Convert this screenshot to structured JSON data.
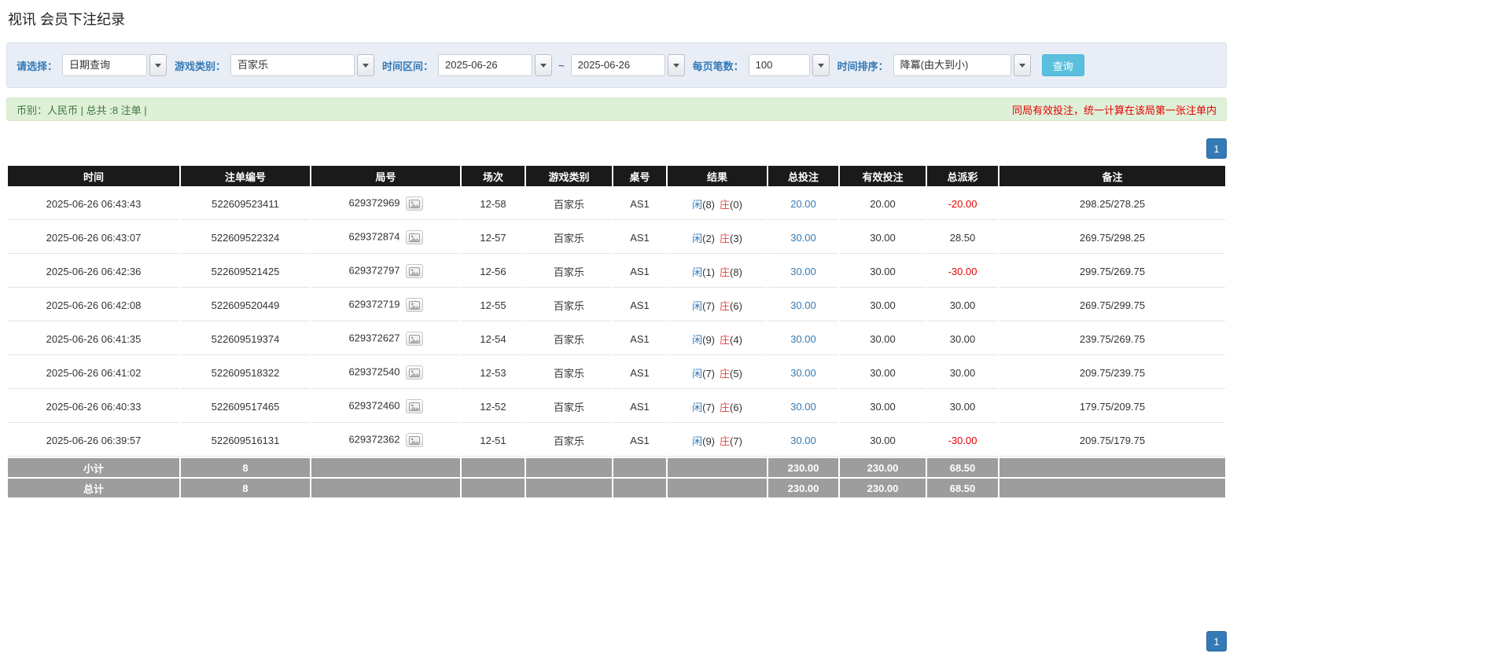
{
  "page": {
    "title": "视讯 会员下注纪录"
  },
  "colors": {
    "accent_blue": "#337ab7",
    "player_blue": "#337ab7",
    "banker_red": "#d9534f",
    "negative_red": "#e60000",
    "search_button_blue": "#5bc0de",
    "header_black": "#1a1a1a",
    "total_row_gray": "#9d9d9d",
    "summary_green_bg": "#dff0d8"
  },
  "filters": {
    "select_label": "请选择：",
    "select_value": "日期查询",
    "game_type_label": "游戏类别：",
    "game_type_value": "百家乐",
    "time_range_label": "时间区间：",
    "date_from": "2025-06-26",
    "tilde": "~",
    "date_to": "2025-06-26",
    "page_size_label": "每页笔数：",
    "page_size_value": "100",
    "sort_label": "时间排序：",
    "sort_value": "降冪(由大到小)",
    "search_button": "查询"
  },
  "summary": {
    "left": "币别：人民币 | 总共 :8 注单 |",
    "right_note": "同局有效投注，统一计算在该局第一张注单内"
  },
  "pagination": {
    "page": "1"
  },
  "table": {
    "headers": [
      "时间",
      "注单编号",
      "局号",
      "场次",
      "游戏类别",
      "桌号",
      "结果",
      "总投注",
      "有效投注",
      "总派彩",
      "备注"
    ],
    "rows": [
      {
        "time": "2025-06-26 06:43:43",
        "bet_id": "522609523411",
        "round_id": "629372969",
        "session": "12-58",
        "game": "百家乐",
        "table_no": "AS1",
        "result": {
          "player": "闲",
          "player_n": "(8)",
          "banker": "庄",
          "banker_n": "(0)"
        },
        "total_bet": "20.00",
        "valid_bet": "20.00",
        "payout": "-20.00",
        "remark": "298.25/278.25"
      },
      {
        "time": "2025-06-26 06:43:07",
        "bet_id": "522609522324",
        "round_id": "629372874",
        "session": "12-57",
        "game": "百家乐",
        "table_no": "AS1",
        "result": {
          "player": "闲",
          "player_n": "(2)",
          "banker": "庄",
          "banker_n": "(3)"
        },
        "total_bet": "30.00",
        "valid_bet": "30.00",
        "payout": "28.50",
        "remark": "269.75/298.25"
      },
      {
        "time": "2025-06-26 06:42:36",
        "bet_id": "522609521425",
        "round_id": "629372797",
        "session": "12-56",
        "game": "百家乐",
        "table_no": "AS1",
        "result": {
          "player": "闲",
          "player_n": "(1)",
          "banker": "庄",
          "banker_n": "(8)"
        },
        "total_bet": "30.00",
        "valid_bet": "30.00",
        "payout": "-30.00",
        "remark": "299.75/269.75"
      },
      {
        "time": "2025-06-26 06:42:08",
        "bet_id": "522609520449",
        "round_id": "629372719",
        "session": "12-55",
        "game": "百家乐",
        "table_no": "AS1",
        "result": {
          "player": "闲",
          "player_n": "(7)",
          "banker": "庄",
          "banker_n": "(6)"
        },
        "total_bet": "30.00",
        "valid_bet": "30.00",
        "payout": "30.00",
        "remark": "269.75/299.75"
      },
      {
        "time": "2025-06-26 06:41:35",
        "bet_id": "522609519374",
        "round_id": "629372627",
        "session": "12-54",
        "game": "百家乐",
        "table_no": "AS1",
        "result": {
          "player": "闲",
          "player_n": "(9)",
          "banker": "庄",
          "banker_n": "(4)"
        },
        "total_bet": "30.00",
        "valid_bet": "30.00",
        "payout": "30.00",
        "remark": "239.75/269.75"
      },
      {
        "time": "2025-06-26 06:41:02",
        "bet_id": "522609518322",
        "round_id": "629372540",
        "session": "12-53",
        "game": "百家乐",
        "table_no": "AS1",
        "result": {
          "player": "闲",
          "player_n": "(7)",
          "banker": "庄",
          "banker_n": "(5)"
        },
        "total_bet": "30.00",
        "valid_bet": "30.00",
        "payout": "30.00",
        "remark": "209.75/239.75"
      },
      {
        "time": "2025-06-26 06:40:33",
        "bet_id": "522609517465",
        "round_id": "629372460",
        "session": "12-52",
        "game": "百家乐",
        "table_no": "AS1",
        "result": {
          "player": "闲",
          "player_n": "(7)",
          "banker": "庄",
          "banker_n": "(6)"
        },
        "total_bet": "30.00",
        "valid_bet": "30.00",
        "payout": "30.00",
        "remark": "179.75/209.75"
      },
      {
        "time": "2025-06-26 06:39:57",
        "bet_id": "522609516131",
        "round_id": "629372362",
        "session": "12-51",
        "game": "百家乐",
        "table_no": "AS1",
        "result": {
          "player": "闲",
          "player_n": "(9)",
          "banker": "庄",
          "banker_n": "(7)"
        },
        "total_bet": "30.00",
        "valid_bet": "30.00",
        "payout": "-30.00",
        "remark": "209.75/179.75"
      }
    ],
    "subtotal": {
      "label": "小计",
      "count": "8",
      "total_bet": "230.00",
      "valid_bet": "230.00",
      "payout": "68.50"
    },
    "total": {
      "label": "总计",
      "count": "8",
      "total_bet": "230.00",
      "valid_bet": "230.00",
      "payout": "68.50"
    }
  }
}
